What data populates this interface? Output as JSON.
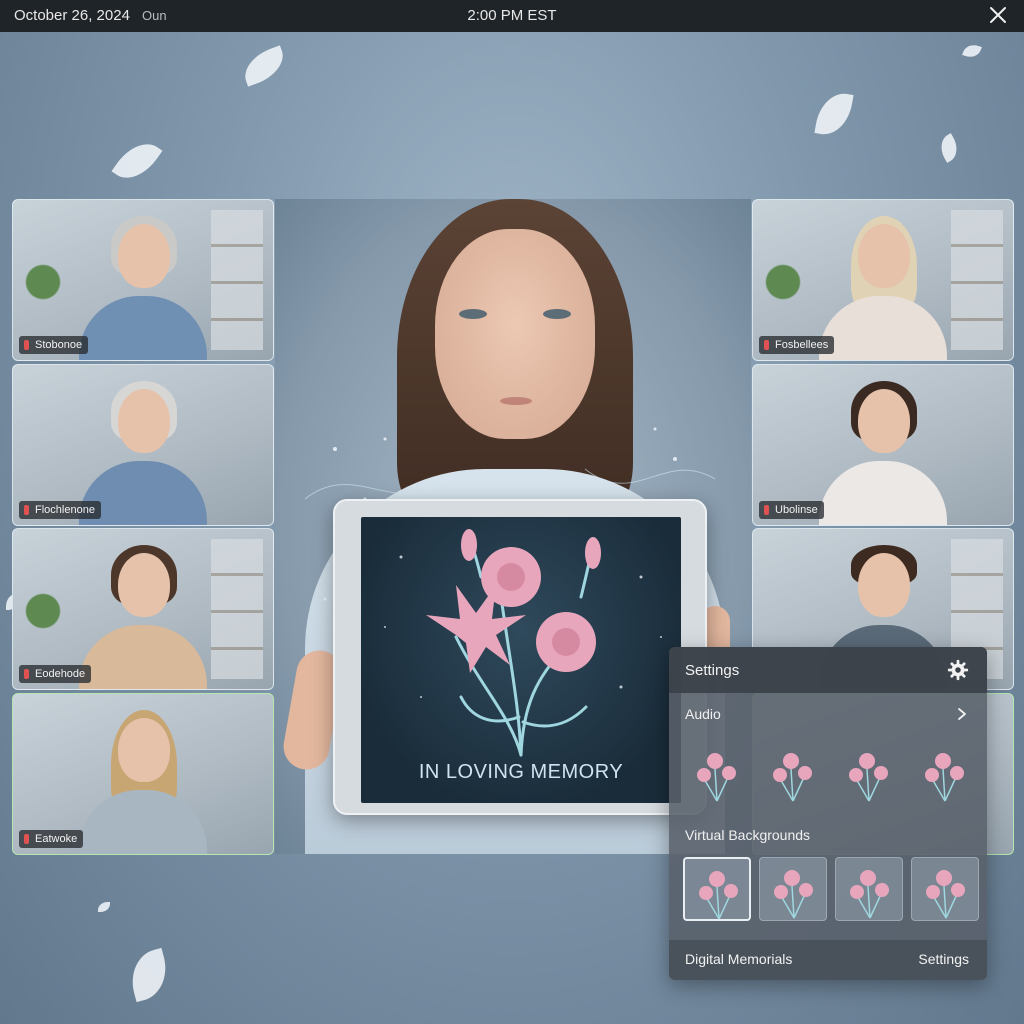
{
  "topbar": {
    "date": "October 26, 2024",
    "date_extra": "Oun",
    "time": "2:00 PM EST",
    "close_icon": "close-icon"
  },
  "participants": [
    {
      "label": "Stobonoe",
      "hair": "#c9c9c7",
      "shirt": "#6f8fb3"
    },
    {
      "label": "Fosbellees",
      "hair": "#e0d3b5",
      "shirt": "#e9dfd9"
    },
    {
      "label": "Flochlenone",
      "hair": "#d6d6d4",
      "shirt": "#6e8db0"
    },
    {
      "label": "Ubolinse",
      "hair": "#3b2a22",
      "shirt": "#ece8e6"
    },
    {
      "label": "Eodehode",
      "hair": "#4d372a",
      "shirt": "#d8b999"
    },
    {
      "label": "",
      "hair": "#3d2b22",
      "shirt": "#5a6a78"
    },
    {
      "label": "Eatwoke",
      "hair": "#c8a673",
      "shirt": "#a8b6c2"
    }
  ],
  "stage": {
    "memorial_text": "IN LOVING MEMORY"
  },
  "settings_panel": {
    "title": "Settings",
    "audio_label": "Audio",
    "virtual_backgrounds_label": "Virtual Backgrounds",
    "footer_left": "Digital Memorials",
    "footer_right": "Settings",
    "icons": {
      "gear": "gear-icon",
      "chevron": "chevron-right-icon"
    }
  },
  "colors": {
    "topbar": "#1f2428",
    "active_tile_border": "#b5e6b0",
    "flower_pink": "#e8a6bd",
    "stem_teal": "#9fd6df"
  }
}
